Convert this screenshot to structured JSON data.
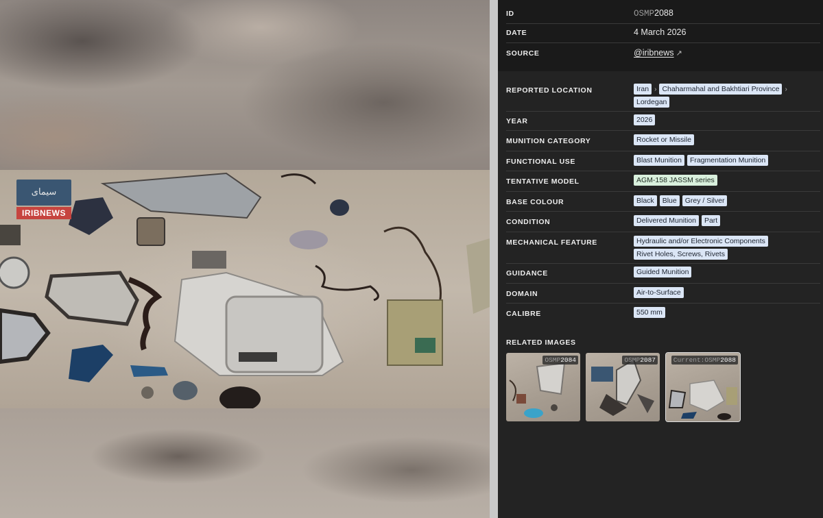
{
  "media": {
    "watermark_logo": "سیمای",
    "watermark_text": "IRIBNEWS"
  },
  "meta": {
    "id_label": "ID",
    "id_prefix": "OSMP",
    "id_number": "2088",
    "date_label": "DATE",
    "date_value": "4 March 2026",
    "source_label": "SOURCE",
    "source_value": "@iribnews",
    "source_icon": "external-link-icon"
  },
  "details": {
    "location": {
      "label": "REPORTED LOCATION",
      "tags": [
        "Iran",
        "Chaharmahal and Bakhtiari Province",
        "Lordegan"
      ]
    },
    "year": {
      "label": "YEAR",
      "tags": [
        "2026"
      ]
    },
    "category": {
      "label": "MUNITION CATEGORY",
      "tags": [
        "Rocket or Missile"
      ]
    },
    "functional": {
      "label": "FUNCTIONAL USE",
      "tags": [
        "Blast Munition",
        "Fragmentation Munition"
      ]
    },
    "model": {
      "label": "TENTATIVE MODEL",
      "tags": [
        "AGM-158 JASSM series"
      ]
    },
    "colour": {
      "label": "BASE COLOUR",
      "tags": [
        "Black",
        "Blue",
        "Grey / Silver"
      ]
    },
    "condition": {
      "label": "CONDITION",
      "tags": [
        "Delivered Munition",
        "Part"
      ]
    },
    "mechanical": {
      "label": "MECHANICAL FEATURE",
      "tags": [
        "Hydraulic and/or Electronic Components",
        "Rivet Holes, Screws, Rivets"
      ]
    },
    "guidance": {
      "label": "GUIDANCE",
      "tags": [
        "Guided Munition"
      ]
    },
    "domain": {
      "label": "DOMAIN",
      "tags": [
        "Air-to-Surface"
      ]
    },
    "calibre": {
      "label": "CALIBRE",
      "tags": [
        "550 mm"
      ]
    }
  },
  "related": {
    "title": "RELATED IMAGES",
    "items": [
      {
        "prefix": "OSMP",
        "number": "2084",
        "current": false,
        "current_label": ""
      },
      {
        "prefix": "OSMP",
        "number": "2087",
        "current": false,
        "current_label": ""
      },
      {
        "prefix": "OSMP",
        "number": "2088",
        "current": true,
        "current_label": "Current:"
      }
    ]
  },
  "colors": {
    "tag_bg": "#dbe6f6",
    "tag_green_bg": "#d9f0dd",
    "panel_bg": "#232323",
    "meta_bg": "#1a1a1a"
  }
}
